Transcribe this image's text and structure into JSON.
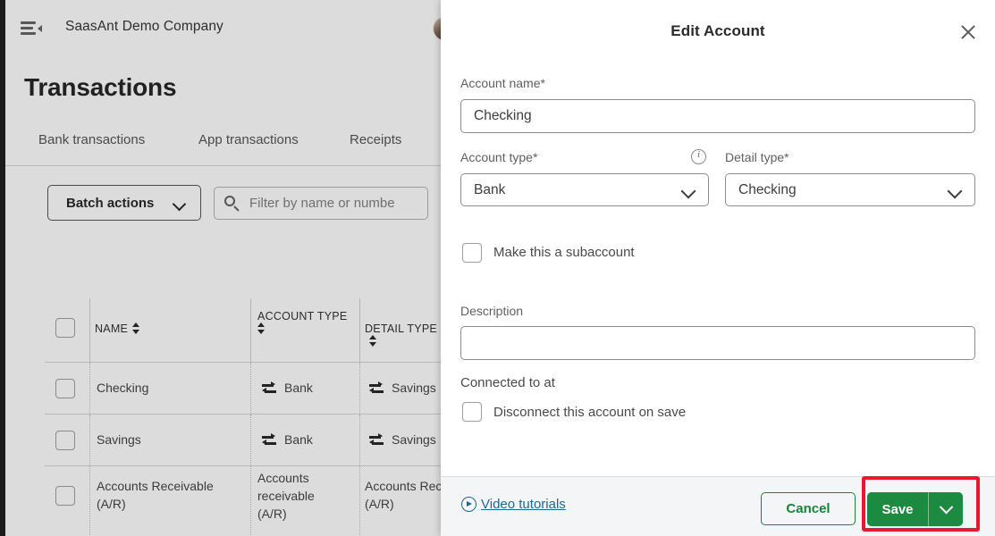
{
  "background": {
    "company_name": "SaasAnt Demo Company",
    "page_title": "Transactions",
    "menu_icon": "hamburger-collapse-icon",
    "tabs": [
      {
        "label": "Bank transactions"
      },
      {
        "label": "App transactions"
      },
      {
        "label": "Receipts"
      }
    ],
    "toolbar": {
      "batch_actions_label": "Batch actions",
      "filter_placeholder": "Filter by name or numbe"
    },
    "table": {
      "columns": [
        {
          "label": "NAME"
        },
        {
          "label": "ACCOUNT TYPE"
        },
        {
          "label": "DETAIL TYPE"
        }
      ],
      "rows": [
        {
          "name": "Checking",
          "account_type": "Bank",
          "detail_type": "Savings"
        },
        {
          "name": "Savings",
          "account_type": "Bank",
          "detail_type": "Savings"
        },
        {
          "name": "Accounts Receivable (A/R)",
          "account_type": "Accounts receivable (A/R)",
          "detail_type": "Accounts Rece (A/R)"
        }
      ]
    }
  },
  "modal": {
    "title": "Edit Account",
    "close_icon": "close-icon",
    "fields": {
      "account_name_label": "Account name*",
      "account_name_value": "Checking",
      "account_type_label": "Account type*",
      "account_type_value": "Bank",
      "account_type_info_icon": "info-icon",
      "detail_type_label": "Detail type*",
      "detail_type_value": "Checking",
      "subaccount_label": "Make this a subaccount",
      "description_label": "Description",
      "description_value": "",
      "connected_label": "Connected to at",
      "disconnect_label": "Disconnect this account on save"
    },
    "footer": {
      "video_tutorials_label": "Video tutorials",
      "video_tutorials_icon": "play-circle-icon",
      "cancel_label": "Cancel",
      "save_label": "Save",
      "save_caret_icon": "chevron-down-icon"
    }
  },
  "annotation": {
    "highlight_color": "#e8192c",
    "highlight_target": "save-button"
  }
}
